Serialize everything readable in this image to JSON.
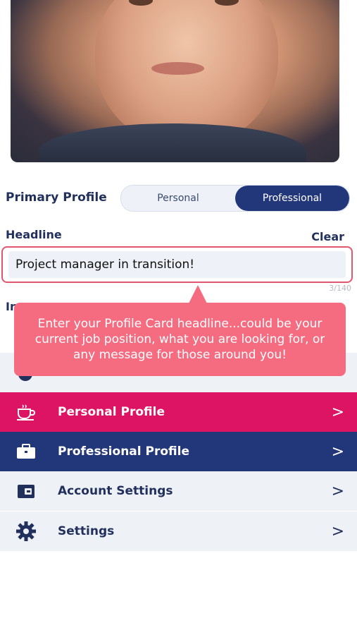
{
  "primary_profile": {
    "label": "Primary Profile",
    "options": [
      "Personal",
      "Professional"
    ],
    "selected": "Professional"
  },
  "headline": {
    "label": "Headline",
    "clear_label": "Clear",
    "value": "Project manager in transition!",
    "counter": "3/140"
  },
  "partial_label": "In",
  "tooltip": {
    "text": "Enter your Profile Card headline...could be your current job position, what you are looking for, or any message for those around you!"
  },
  "menu": {
    "items": [
      {
        "label": "Personal Profile",
        "icon": "coffee-cup-icon",
        "chevron": ">"
      },
      {
        "label": "Professional Profile",
        "icon": "briefcase-icon",
        "chevron": ">"
      },
      {
        "label": "Account Settings",
        "icon": "wallet-icon",
        "chevron": ">"
      },
      {
        "label": "Settings",
        "icon": "gear-icon",
        "chevron": ">"
      }
    ]
  },
  "colors": {
    "accent_pink": "#dd1464",
    "navy": "#22377a",
    "tooltip_pink": "#f56b80",
    "text_navy": "#22305e"
  }
}
